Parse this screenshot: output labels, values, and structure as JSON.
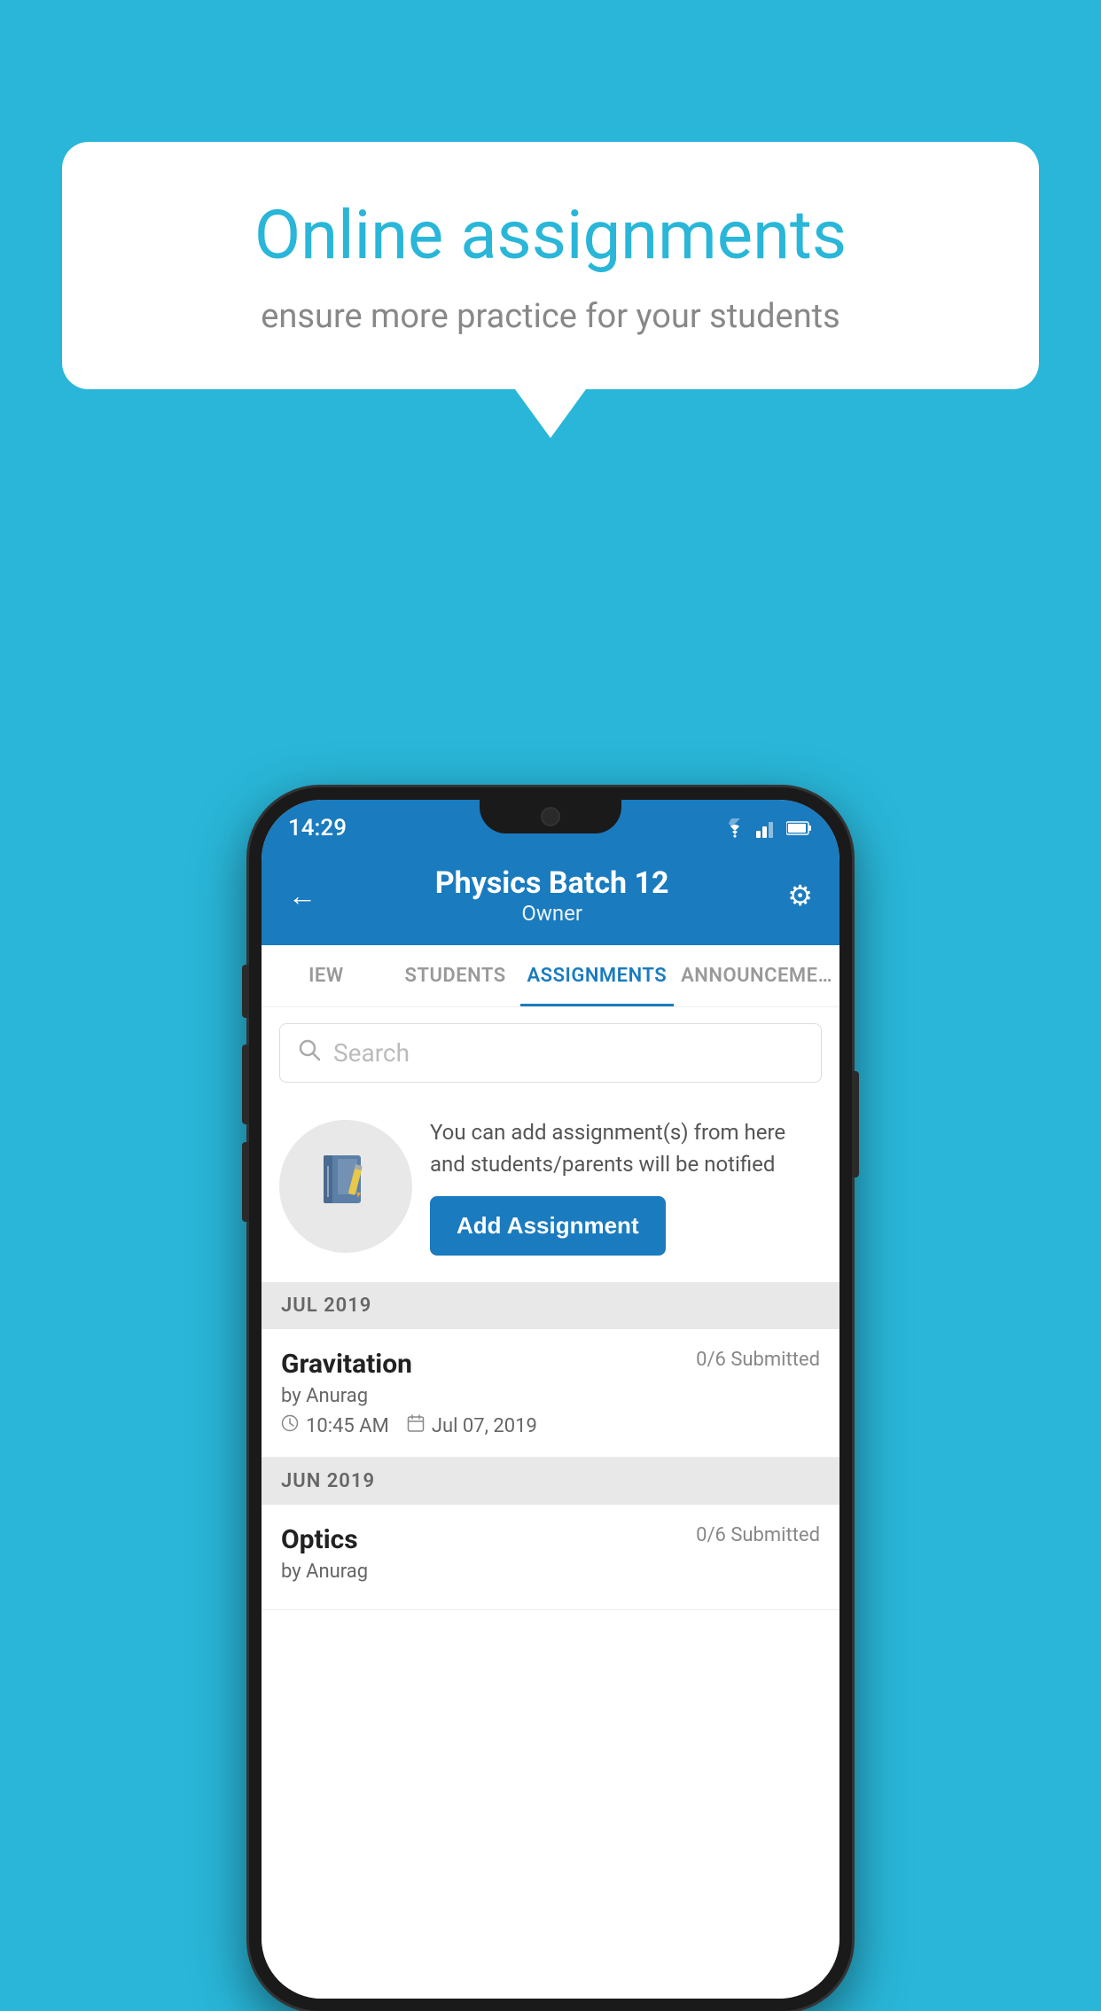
{
  "background_color": "#29b6d8",
  "speech_bubble": {
    "title": "Online assignments",
    "subtitle": "ensure more practice for your students"
  },
  "status_bar": {
    "time": "14:29",
    "wifi": "▲",
    "signal": "▲",
    "battery": "▪"
  },
  "header": {
    "title": "Physics Batch 12",
    "subtitle": "Owner",
    "back_label": "←",
    "settings_label": "⚙"
  },
  "tabs": [
    {
      "label": "IEW",
      "active": false
    },
    {
      "label": "STUDENTS",
      "active": false
    },
    {
      "label": "ASSIGNMENTS",
      "active": true
    },
    {
      "label": "ANNOUNCEMENTS",
      "active": false
    }
  ],
  "search": {
    "placeholder": "Search"
  },
  "promo": {
    "text": "You can add assignment(s) from here and students/parents will be notified",
    "button_label": "Add Assignment"
  },
  "sections": [
    {
      "month": "JUL 2019",
      "assignments": [
        {
          "name": "Gravitation",
          "submitted": "0/6 Submitted",
          "by": "by Anurag",
          "time": "10:45 AM",
          "date": "Jul 07, 2019"
        }
      ]
    },
    {
      "month": "JUN 2019",
      "assignments": [
        {
          "name": "Optics",
          "submitted": "0/6 Submitted",
          "by": "by Anurag",
          "time": "",
          "date": ""
        }
      ]
    }
  ]
}
